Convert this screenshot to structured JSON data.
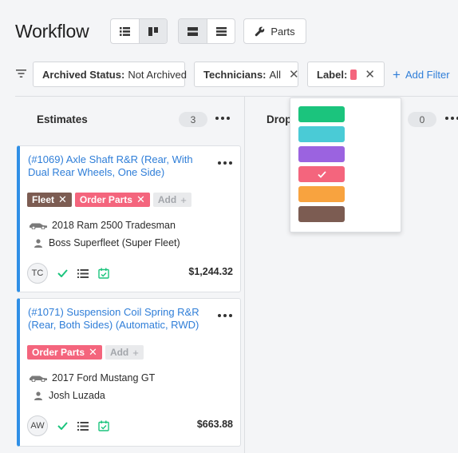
{
  "header": {
    "title": "Workflow",
    "parts_label": "Parts"
  },
  "filters": {
    "archived": {
      "key": "Archived Status:",
      "value": "Not Archived"
    },
    "technicians": {
      "key": "Technicians:",
      "value": "All"
    },
    "label": {
      "key": "Label:",
      "color": "#f4657d"
    },
    "add_filter": "Add Filter"
  },
  "columns": [
    {
      "name": "Estimates",
      "count": "3"
    },
    {
      "name": "Drop",
      "count": "0"
    }
  ],
  "label_colors": [
    {
      "name": "green",
      "color": "#1bc47d",
      "selected": false
    },
    {
      "name": "teal",
      "color": "#4acbd6",
      "selected": false
    },
    {
      "name": "purple",
      "color": "#9b63e0",
      "selected": false
    },
    {
      "name": "pink",
      "color": "#f4657d",
      "selected": true
    },
    {
      "name": "orange",
      "color": "#f8a33f",
      "selected": false
    },
    {
      "name": "brown",
      "color": "#7c5c52",
      "selected": false
    }
  ],
  "cards": [
    {
      "title": "(#1069) Axle Shaft R&R (Rear, With Dual Rear Wheels, One Side)",
      "tags": [
        "Fleet",
        "Order Parts"
      ],
      "add_label": "Add",
      "vehicle": "2018 Ram 2500 Tradesman",
      "customer": "Boss Superfleet (Super Fleet)",
      "initials": "TC",
      "price": "$1,244.32"
    },
    {
      "title": "(#1071) Suspension Coil Spring R&R (Rear, Both Sides) (Automatic, RWD)",
      "tags": [
        "Order Parts"
      ],
      "add_label": "Add",
      "vehicle": "2017 Ford Mustang GT",
      "customer": "Josh Luzada",
      "initials": "AW",
      "price": "$663.88"
    }
  ],
  "colors": {
    "accent": "#2f7ed8",
    "card_border": "#2f8fe6",
    "check_green": "#1bc47d"
  }
}
